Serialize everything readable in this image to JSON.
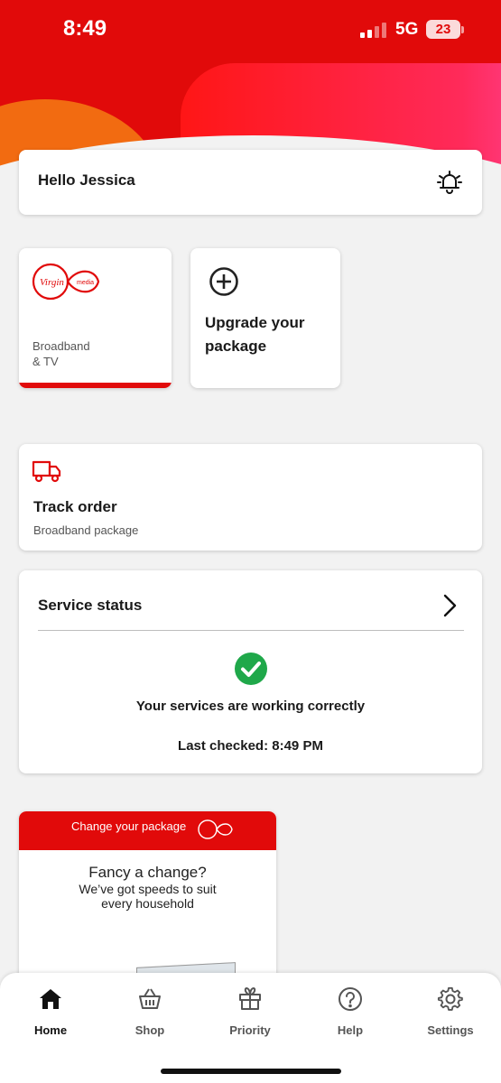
{
  "status_bar": {
    "time": "8:49",
    "network": "5G",
    "battery": "23"
  },
  "greeting": {
    "text": "Hello Jessica",
    "icon": "bell-icon"
  },
  "tiles": {
    "broadband": {
      "label_line1": "Broadband",
      "label_line2": "& TV",
      "logo": "virgin-media-logo"
    },
    "upgrade": {
      "label_line1": "Upgrade your",
      "label_line2": "package",
      "icon": "plus-circle-icon"
    }
  },
  "track_order": {
    "title": "Track order",
    "subtitle": "Broadband package",
    "icon": "truck-icon"
  },
  "service_status": {
    "title": "Service status",
    "message": "Your services are working correctly",
    "last_checked": "Last checked: 8:49 PM",
    "icon": "check-circle-icon"
  },
  "promo": {
    "header": "Change your package",
    "line1": "Fancy a change?",
    "line2": "We’ve got speeds to suit",
    "line3": "every household"
  },
  "tab_bar": {
    "tabs": [
      {
        "label": "Home",
        "icon": "home-icon",
        "active": true
      },
      {
        "label": "Shop",
        "icon": "basket-icon",
        "active": false
      },
      {
        "label": "Priority",
        "icon": "gift-icon",
        "active": false
      },
      {
        "label": "Help",
        "icon": "question-icon",
        "active": false
      },
      {
        "label": "Settings",
        "icon": "gear-icon",
        "active": false
      }
    ]
  },
  "colors": {
    "brand_red": "#e10a0a",
    "success_green": "#1fa84a"
  }
}
